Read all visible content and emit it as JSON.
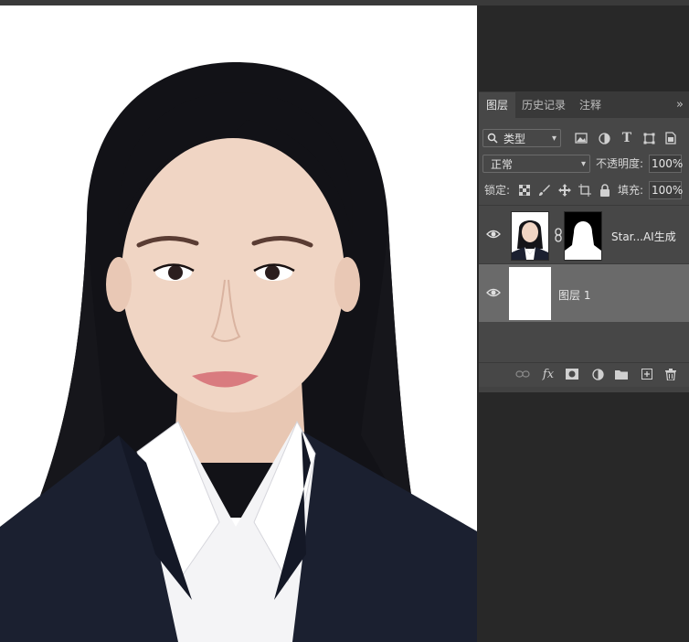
{
  "tabs": [
    {
      "label": "图层",
      "active": true
    },
    {
      "label": "历史记录",
      "active": false
    },
    {
      "label": "注释",
      "active": false
    }
  ],
  "tabs_overflow": "»",
  "filter": {
    "label": "类型",
    "icons": [
      "image-filter-icon",
      "adjustment-filter-icon",
      "text-filter-icon",
      "shape-filter-icon",
      "smart-object-filter-icon"
    ]
  },
  "blend": {
    "mode": "正常",
    "opacity_label": "不透明度:",
    "opacity": "100%"
  },
  "lock": {
    "label": "锁定:",
    "fill_label": "填充:",
    "fill": "100%"
  },
  "layers": [
    {
      "name": "Star...AI生成",
      "visible": true,
      "selected": false,
      "has_mask": true
    },
    {
      "name": "图层 1",
      "visible": true,
      "selected": true,
      "has_mask": false
    }
  ],
  "colors": {
    "panel": "#474747",
    "selected_layer": "#6a6a6a",
    "canvas_bg": "#ffffff",
    "suit": "#1a1f2e"
  }
}
